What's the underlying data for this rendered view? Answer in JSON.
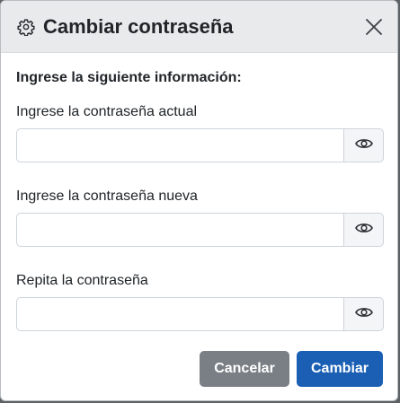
{
  "dialog": {
    "title": "Cambiar contraseña",
    "instruction": "Ingrese la siguiente información:"
  },
  "fields": [
    {
      "label": "Ingrese la contraseña actual",
      "value": "",
      "placeholder": ""
    },
    {
      "label": "Ingrese la contraseña nueva",
      "value": "",
      "placeholder": ""
    },
    {
      "label": "Repita la contraseña",
      "value": "",
      "placeholder": ""
    }
  ],
  "footer": {
    "cancel_label": "Cancelar",
    "submit_label": "Cambiar"
  },
  "icons": {
    "header": "gear-icon",
    "close": "close-icon",
    "toggle": "eye-icon"
  },
  "colors": {
    "header_bg": "#e9eaec",
    "cancel_bg": "#7a7f85",
    "primary_bg": "#1a5fb4"
  }
}
